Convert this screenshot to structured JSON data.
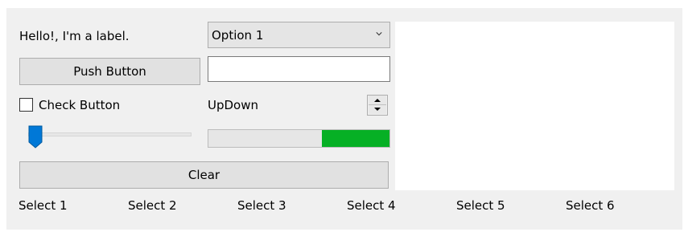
{
  "label": {
    "text": "Hello!, I'm a label."
  },
  "combobox": {
    "selected": "Option 1"
  },
  "push_button": {
    "label": "Push Button"
  },
  "entry": {
    "value": ""
  },
  "check_button": {
    "label": "Check Button",
    "checked": false
  },
  "updown": {
    "label": "UpDown"
  },
  "slider": {
    "value_fraction": 0.0
  },
  "progress": {
    "value_fraction": 0.375,
    "fill_color": "#06b025"
  },
  "clear_button": {
    "label": "Clear"
  },
  "select_items": [
    {
      "label": "Select 1"
    },
    {
      "label": "Select 2"
    },
    {
      "label": "Select 3"
    },
    {
      "label": "Select 4"
    },
    {
      "label": "Select 5"
    },
    {
      "label": "Select 6"
    }
  ],
  "colors": {
    "window_bg": "#f0f0f0",
    "slider_thumb": "#0078d7"
  }
}
